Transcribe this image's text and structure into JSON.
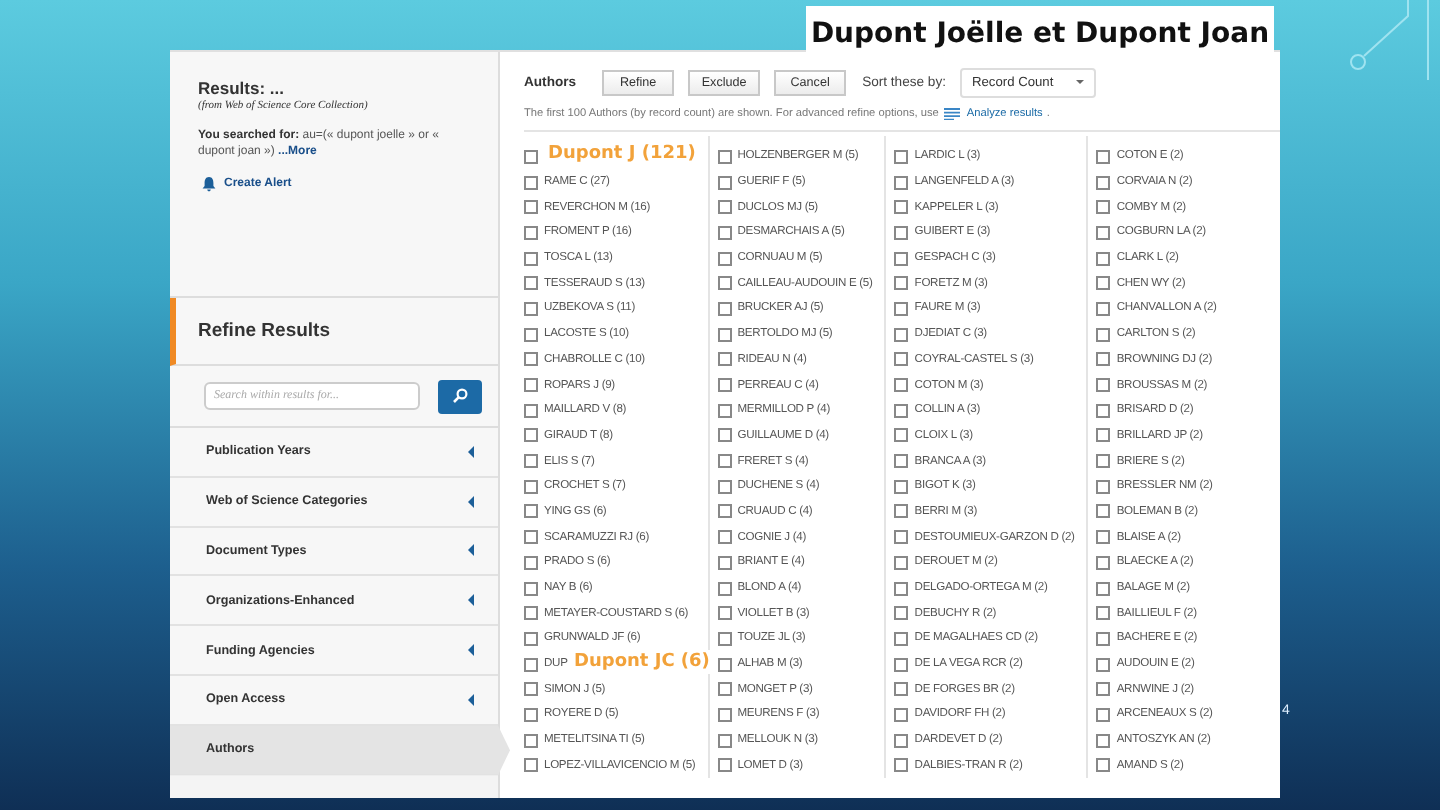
{
  "slide": {
    "title": "Dupont Joëlle et Dupont Joan",
    "page_number": "4"
  },
  "sidebar": {
    "results_title": "Results: ...",
    "results_source": "(from Web of Science Core Collection)",
    "searched": "**You searched for:** au=(« dupont joelle » or « dupont joan »)",
    "more_link": "...More",
    "alert_link": "Create Alert",
    "refine_title": "Refine Results",
    "search": {
      "placeholder": "Search within results for..."
    },
    "facets": [
      {
        "label": "Publication Years",
        "selected": false
      },
      {
        "label": "Web of Science Categories",
        "selected": false
      },
      {
        "label": "Document Types",
        "selected": false
      },
      {
        "label": "Organizations-Enhanced",
        "selected": false
      },
      {
        "label": "Funding Agencies",
        "selected": false
      },
      {
        "label": "Open Access",
        "selected": false
      },
      {
        "label": "Authors",
        "selected": true
      }
    ]
  },
  "authors_panel": {
    "title": "Authors",
    "buttons": [
      "Refine",
      "Exclude",
      "Cancel"
    ],
    "sort_label": "Sort these by:",
    "sort_value": "Record Count",
    "note": "The first 100 Authors (by record count) are shown. For advanced refine options, use",
    "analyze_link": "Analyze results",
    "note_end": ".",
    "columns": [
      [
        {
          "checked": false
        },
        {
          "label": "RAME C (27)",
          "checked": false
        },
        {
          "label": "REVERCHON M (16)",
          "checked": false
        },
        {
          "label": "FROMENT P (16)",
          "checked": false
        },
        {
          "label": "TOSCA L (13)",
          "checked": false
        },
        {
          "label": "TESSERAUD S (13)",
          "checked": false
        },
        {
          "label": "UZBEKOVA S (11)",
          "checked": false
        },
        {
          "label": "LACOSTE S (10)",
          "checked": false
        },
        {
          "label": "CHABROLLE C (10)",
          "checked": false
        },
        {
          "label": "ROPARS J (9)",
          "checked": false
        },
        {
          "label": "MAILLARD V (8)",
          "checked": false
        },
        {
          "label": "GIRAUD T (8)",
          "checked": false
        },
        {
          "label": "ELIS S (7)",
          "checked": false
        },
        {
          "label": "CROCHET S (7)",
          "checked": false
        },
        {
          "label": "YING GS (6)",
          "checked": false
        },
        {
          "label": "SCARAMUZZI RJ (6)",
          "checked": false
        },
        {
          "label": "PRADO S (6)",
          "checked": false
        },
        {
          "label": "NAY B (6)",
          "checked": false
        },
        {
          "label": "METAYER-COUSTARD S (6)",
          "checked": false
        },
        {
          "label": "GRUNWALD JF (6)",
          "checked": false
        },
        {
          "label": "DUP",
          "checked": false
        },
        {
          "label": "SIMON J (5)",
          "checked": false
        },
        {
          "label": "ROYERE D (5)",
          "checked": false
        },
        {
          "label": "METELITSINA TI (5)",
          "checked": false
        },
        {
          "label": "LOPEZ-VILLAVICENCIO M (5)",
          "checked": false
        }
      ],
      [
        {
          "label": "HOLZENBERGER M (5)",
          "checked": false
        },
        {
          "label": "GUERIF F (5)",
          "checked": false
        },
        {
          "label": "DUCLOS MJ (5)",
          "checked": false
        },
        {
          "label": "DESMARCHAIS A (5)",
          "checked": false
        },
        {
          "label": "CORNUAU M (5)",
          "checked": false
        },
        {
          "label": "CAILLEAU-AUDOUIN E (5)",
          "checked": false
        },
        {
          "label": "BRUCKER AJ (5)",
          "checked": false
        },
        {
          "label": "BERTOLDO MJ (5)",
          "checked": false
        },
        {
          "label": "RIDEAU N (4)",
          "checked": false
        },
        {
          "label": "PERREAU C (4)",
          "checked": false
        },
        {
          "label": "MERMILLOD P (4)",
          "checked": false
        },
        {
          "label": "GUILLAUME D (4)",
          "checked": false
        },
        {
          "label": "FRERET S (4)",
          "checked": false
        },
        {
          "label": "DUCHENE S (4)",
          "checked": false
        },
        {
          "label": "CRUAUD C (4)",
          "checked": false
        },
        {
          "label": "COGNIE J (4)",
          "checked": false
        },
        {
          "label": "BRIANT E (4)",
          "checked": false
        },
        {
          "label": "BLOND A (4)",
          "checked": false
        },
        {
          "label": "VIOLLET B (3)",
          "checked": false
        },
        {
          "label": "TOUZE JL (3)",
          "checked": false
        },
        {
          "label": "ALHAB M (3)",
          "checked": false
        },
        {
          "label": "MONGET P (3)",
          "checked": false
        },
        {
          "label": "MEURENS F (3)",
          "checked": false
        },
        {
          "label": "MELLOUK N (3)",
          "checked": false
        },
        {
          "label": "LOMET D (3)",
          "checked": false
        }
      ],
      [
        {
          "label": "LARDIC L (3)",
          "checked": false
        },
        {
          "label": "LANGENFELD A (3)",
          "checked": false
        },
        {
          "label": "KAPPELER L (3)",
          "checked": false
        },
        {
          "label": "GUIBERT E (3)",
          "checked": false
        },
        {
          "label": "GESPACH C (3)",
          "checked": false
        },
        {
          "label": "FORETZ M (3)",
          "checked": false
        },
        {
          "label": "FAURE M (3)",
          "checked": false
        },
        {
          "label": "DJEDIAT C (3)",
          "checked": false
        },
        {
          "label": "COYRAL-CASTEL S (3)",
          "checked": false
        },
        {
          "label": "COTON M (3)",
          "checked": false
        },
        {
          "label": "COLLIN A (3)",
          "checked": false
        },
        {
          "label": "CLOIX L (3)",
          "checked": false
        },
        {
          "label": "BRANCA A (3)",
          "checked": false
        },
        {
          "label": "BIGOT K (3)",
          "checked": false
        },
        {
          "label": "BERRI M (3)",
          "checked": false
        },
        {
          "label": "DESTOUMIEUX-GARZON D (2)",
          "checked": false
        },
        {
          "label": "DEROUET M (2)",
          "checked": false
        },
        {
          "label": "DELGADO-ORTEGA M (2)",
          "checked": false
        },
        {
          "label": "DEBUCHY R (2)",
          "checked": false
        },
        {
          "label": "DE MAGALHAES CD (2)",
          "checked": false
        },
        {
          "label": "DE LA VEGA RCR (2)",
          "checked": false
        },
        {
          "label": "DE FORGES BR (2)",
          "checked": false
        },
        {
          "label": "DAVIDORF FH (2)",
          "checked": false
        },
        {
          "label": "DARDEVET D (2)",
          "checked": false
        },
        {
          "label": "DALBIES-TRAN R (2)",
          "checked": false
        }
      ],
      [
        {
          "label": "COTON E (2)",
          "checked": false
        },
        {
          "label": "CORVAIA N (2)",
          "checked": false
        },
        {
          "label": "COMBY M (2)",
          "checked": false
        },
        {
          "label": "COGBURN LA (2)",
          "checked": false
        },
        {
          "label": "CLARK L (2)",
          "checked": false
        },
        {
          "label": "CHEN WY (2)",
          "checked": false
        },
        {
          "label": "CHANVALLON A (2)",
          "checked": false
        },
        {
          "label": "CARLTON S (2)",
          "checked": false
        },
        {
          "label": "BROWNING DJ (2)",
          "checked": false
        },
        {
          "label": "BROUSSAS M (2)",
          "checked": false
        },
        {
          "label": "BRISARD D (2)",
          "checked": false
        },
        {
          "label": "BRILLARD JP (2)",
          "checked": false
        },
        {
          "label": "BRIERE S (2)",
          "checked": false
        },
        {
          "label": "BRESSLER NM (2)",
          "checked": false
        },
        {
          "label": "BOLEMAN B (2)",
          "checked": false
        },
        {
          "label": "BLAISE A (2)",
          "checked": false
        },
        {
          "label": "BLAECKE A (2)",
          "checked": false
        },
        {
          "label": "BALAGE M (2)",
          "checked": false
        },
        {
          "label": "BAILLIEUL F (2)",
          "checked": false
        },
        {
          "label": "BACHERE E (2)",
          "checked": false
        },
        {
          "label": "AUDOUIN E (2)",
          "checked": false
        },
        {
          "label": "ARNWINE J (2)",
          "checked": false
        },
        {
          "label": "ARCENEAUX S (2)",
          "checked": false
        },
        {
          "label": "ANTOSZYK AN (2)",
          "checked": false
        },
        {
          "label": "AMAND S (2)",
          "checked": false
        }
      ]
    ]
  },
  "callouts": [
    {
      "text": "Dupont J (121)"
    },
    {
      "text": "Dupont JC (6)"
    }
  ]
}
